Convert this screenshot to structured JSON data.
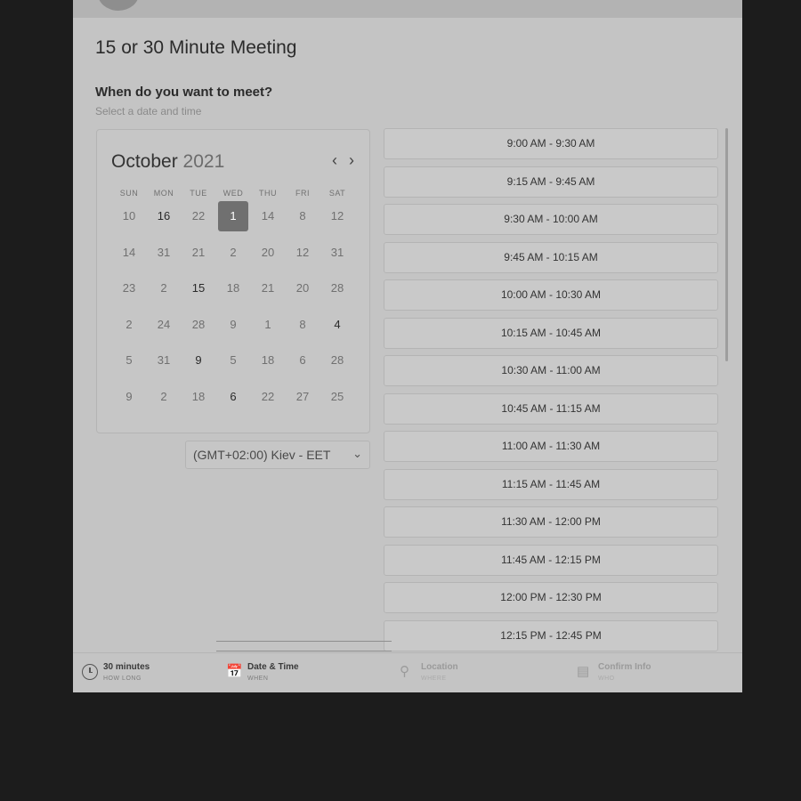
{
  "page": {
    "title": "15 or 30 Minute Meeting",
    "question": "When do you want to meet?",
    "subtitle": "Select a date and time"
  },
  "calendar": {
    "month": "October",
    "year": "2021",
    "prev_icon": "chevron-left-icon",
    "next_icon": "chevron-right-icon",
    "weekdays": [
      "SUN",
      "MON",
      "TUE",
      "WED",
      "THU",
      "FRI",
      "SAT"
    ],
    "weeks": [
      [
        "10",
        "16",
        "22",
        "1",
        "14",
        "8",
        "12"
      ],
      [
        "14",
        "31",
        "21",
        "2",
        "20",
        "12",
        "31"
      ],
      [
        "23",
        "2",
        "15",
        "18",
        "21",
        "20",
        "28"
      ],
      [
        "2",
        "24",
        "28",
        "9",
        "1",
        "8",
        "4"
      ],
      [
        "5",
        "31",
        "9",
        "5",
        "18",
        "6",
        "28"
      ],
      [
        "9",
        "2",
        "18",
        "6",
        "22",
        "27",
        "25"
      ]
    ],
    "selected_day": "1"
  },
  "timezone": {
    "value": "(GMT+02:00) Kiev - EET",
    "icon": "chevron-down-icon"
  },
  "time_slots": [
    "9:00 AM - 9:30 AM",
    "9:15 AM - 9:45 AM",
    "9:30 AM - 10:00 AM",
    "9:45 AM - 10:15 AM",
    "10:00 AM - 10:30 AM",
    "10:15 AM - 10:45 AM",
    "10:30 AM - 11:00 AM",
    "10:45 AM - 11:15 AM",
    "11:00 AM - 11:30 AM",
    "11:15 AM - 11:45 AM",
    "11:30 AM - 12:00 PM",
    "11:45 AM - 12:15 PM",
    "12:00 PM - 12:30 PM",
    "12:15 PM - 12:45 PM"
  ],
  "steps": [
    {
      "label": "30 minutes",
      "sub": "HOW LONG",
      "icon": "clock-icon"
    },
    {
      "label": "Date & Time",
      "sub": "WHEN",
      "icon": "calendar-icon"
    },
    {
      "label": "Location",
      "sub": "WHERE",
      "icon": "location-pin-icon"
    },
    {
      "label": "Confirm Info",
      "sub": "WHO",
      "icon": "document-icon"
    }
  ]
}
